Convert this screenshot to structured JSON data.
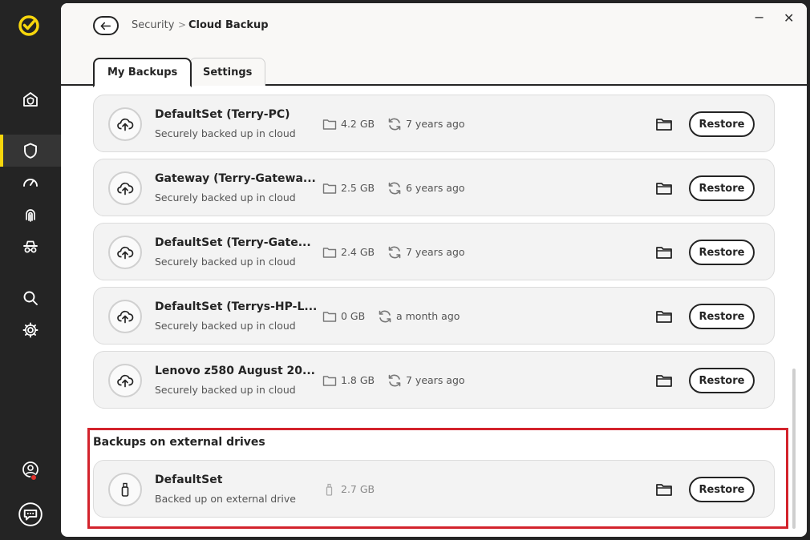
{
  "breadcrumb": {
    "parent": "Security",
    "separator": ">",
    "current": "Cloud Backup"
  },
  "window": {
    "minimize": "−",
    "close": "✕"
  },
  "tabs": [
    {
      "label": "My Backups",
      "active": true
    },
    {
      "label": "Settings",
      "active": false
    }
  ],
  "sidebar": {
    "items": [
      {
        "icon": "home-shield-icon"
      },
      {
        "icon": "shield-icon",
        "active": true
      },
      {
        "icon": "speedometer-icon"
      },
      {
        "icon": "fingerprint-icon"
      },
      {
        "icon": "incognito-icon"
      },
      {
        "icon": "search-icon"
      },
      {
        "icon": "gear-icon"
      },
      {
        "icon": "user-account-icon"
      },
      {
        "icon": "chat-icon"
      }
    ]
  },
  "cloud_backups": [
    {
      "name": "DefaultSet (Terry-PC)",
      "status": "Securely backed up in cloud",
      "size": "4.2 GB",
      "age": "7 years ago",
      "action": "Restore"
    },
    {
      "name": "Gateway (Terry-Gatewa...",
      "status": "Securely backed up in cloud",
      "size": "2.5 GB",
      "age": "6 years ago",
      "action": "Restore"
    },
    {
      "name": "DefaultSet (Terry-Gate...",
      "status": "Securely backed up in cloud",
      "size": "2.4 GB",
      "age": "7 years ago",
      "action": "Restore"
    },
    {
      "name": "DefaultSet (Terrys-HP-L...",
      "status": "Securely backed up in cloud",
      "size": "0 GB",
      "age": "a month ago",
      "action": "Restore"
    },
    {
      "name": "Lenovo z580 August 20...",
      "status": "Securely backed up in cloud",
      "size": "1.8 GB",
      "age": "7 years ago",
      "action": "Restore"
    }
  ],
  "external_section": {
    "title": "Backups on external drives",
    "items": [
      {
        "name": "DefaultSet",
        "status": "Backed up on external drive",
        "size": "2.7 GB",
        "action": "Restore"
      }
    ]
  },
  "colors": {
    "accent": "#f7d60c",
    "highlight": "#d3232c",
    "sidebar": "#242424"
  }
}
